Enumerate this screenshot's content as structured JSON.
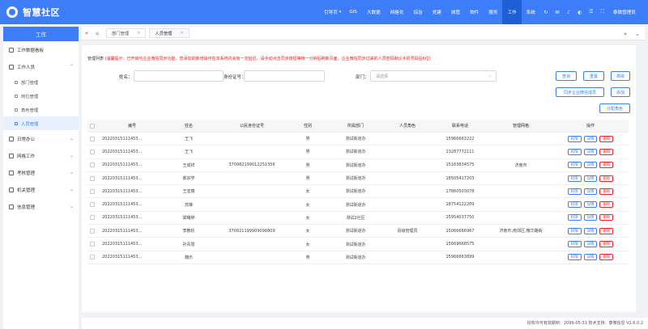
{
  "app": {
    "title": "智慧社区"
  },
  "topnav": {
    "items": [
      {
        "label": "引导页",
        "active": false,
        "has_caret": true
      },
      {
        "label": "GIS",
        "active": false
      },
      {
        "label": "大数据",
        "active": false
      },
      {
        "label": "网格化",
        "active": false
      },
      {
        "label": "综治",
        "active": false
      },
      {
        "label": "党建",
        "active": false
      },
      {
        "label": "城管",
        "active": false
      },
      {
        "label": "物件",
        "active": false
      },
      {
        "label": "服务",
        "active": false
      },
      {
        "label": "工作",
        "active": true
      },
      {
        "label": "系统",
        "active": false
      }
    ],
    "icons": [
      "refresh-icon",
      "message-icon",
      "bell-icon",
      "skin-icon",
      "lock-icon",
      "fullscreen-icon"
    ],
    "user": "泰微管理员"
  },
  "sidebar": {
    "header": "工作",
    "items": [
      {
        "label": "工作数据看板",
        "expandable": false
      },
      {
        "label": "工作人员",
        "expandable": true,
        "expanded": true,
        "children": [
          {
            "label": "部门管理",
            "active": false
          },
          {
            "label": "岗位管理",
            "active": false
          },
          {
            "label": "角色管理",
            "active": false
          },
          {
            "label": "人员管理",
            "active": true
          }
        ]
      },
      {
        "label": "日常办公",
        "expandable": true
      },
      {
        "label": "网格工作",
        "expandable": true
      },
      {
        "label": "考核管理",
        "expandable": true
      },
      {
        "label": "机关管理",
        "expandable": true
      },
      {
        "label": "信息管理",
        "expandable": true
      }
    ]
  },
  "tabs": [
    {
      "label": "部门管理",
      "active": false
    },
    {
      "label": "人员管理",
      "active": true
    }
  ],
  "notice": {
    "prefix": "管理列表",
    "text": "(温馨提示：已开启与企业微信同步功能，您添加的新增操作在本系统内会有一定延迟，请手动点击同步按钮等待一分钟后刷新页面，企业微信同步过来的人员密码默认手机号码后6位)"
  },
  "filters": {
    "name_label": "姓名：",
    "idcard_label": "身份证号：",
    "dept_label": "部门：",
    "dept_placeholder": "请选择"
  },
  "buttons": {
    "search": "查询",
    "reset": "重置",
    "advanced": "高级",
    "sync": "同步企业微信成员",
    "add": "添加",
    "assign_role": "分配角色"
  },
  "table": {
    "headers": [
      "编号",
      "姓名",
      "公民身份证号",
      "性别",
      "所属部门",
      "人员角色",
      "联系电话",
      "管理网格",
      "操作"
    ],
    "op_labels": {
      "auth": "权限",
      "edit": "详情",
      "del": "删除"
    },
    "rows": [
      {
        "id": "20220315111453...",
        "name": "王飞",
        "idcard": "",
        "sex": "男",
        "dept": "测试街道办",
        "role": "",
        "phone": "15966663222",
        "grid": ""
      },
      {
        "id": "20220315111453...",
        "name": "王飞",
        "idcard": "",
        "sex": "男",
        "dept": "测试街道办",
        "role": "",
        "phone": "13287772111",
        "grid": ""
      },
      {
        "id": "20220315111453...",
        "name": "王成祥",
        "idcard": "370982199012251356",
        "sex": "男",
        "dept": "测试街道办",
        "role": "",
        "phone": "15163834575",
        "grid": "济南市"
      },
      {
        "id": "20220315111453...",
        "name": "郝宗学",
        "idcard": "",
        "sex": "男",
        "dept": "测试街道办",
        "role": "",
        "phone": "18505417203",
        "grid": ""
      },
      {
        "id": "20220315111453...",
        "name": "王亚丽",
        "idcard": "",
        "sex": "女",
        "dept": "测试街道办",
        "role": "",
        "phone": "17860503078",
        "grid": ""
      },
      {
        "id": "20220315111453...",
        "name": "苏琳",
        "idcard": "",
        "sex": "女",
        "dept": "测试街道办",
        "role": "",
        "phone": "18754122209",
        "grid": ""
      },
      {
        "id": "20220315111453...",
        "name": "郑曙婷",
        "idcard": "",
        "sex": "女",
        "dept": "测试2社区",
        "role": "",
        "phone": "15954037750",
        "grid": ""
      },
      {
        "id": "20220315111453...",
        "name": "李教析",
        "idcard": "370921199909090809",
        "sex": "女",
        "dept": "测试街道办",
        "role": "县级管理员",
        "phone": "15066666967",
        "grid": "济南市,南郊区,槐华路街"
      },
      {
        "id": "20220315111453...",
        "name": "孙青慧",
        "idcard": "",
        "sex": "女",
        "dept": "测试街道办",
        "role": "",
        "phone": "15669668575",
        "grid": ""
      },
      {
        "id": "20220315111453...",
        "name": "魏乐",
        "idcard": "",
        "sex": "男",
        "dept": "测试街道办",
        "role": "",
        "phone": "15966663899",
        "grid": ""
      }
    ]
  },
  "footer": {
    "text": "授权许可有效期到：2099-05-31 技术支持：泰微信息 V2.6.0.2"
  },
  "colors": {
    "primary": "#3d7ef8",
    "danger": "#f5222d",
    "notice": "#e02020"
  }
}
